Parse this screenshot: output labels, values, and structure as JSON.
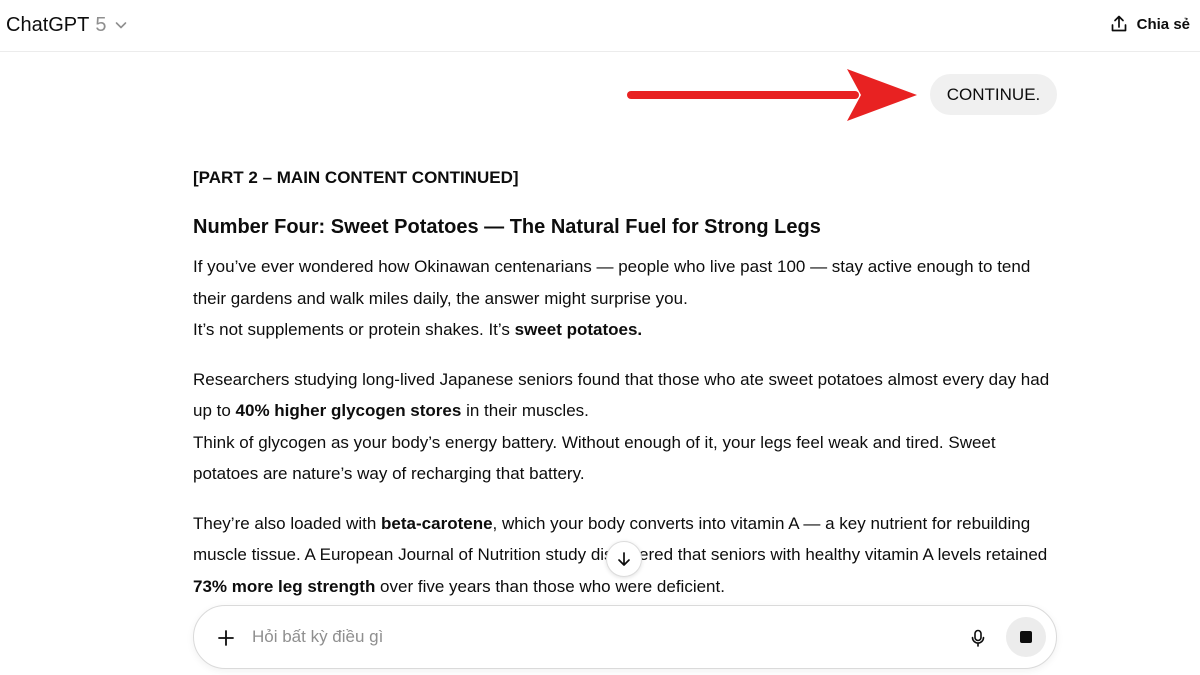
{
  "header": {
    "model_name": "ChatGPT",
    "model_version": "5",
    "share_label": "Chia sẻ"
  },
  "conversation": {
    "user_message": "CONTINUE.",
    "assistant": {
      "part_title": "[PART 2 – MAIN CONTENT CONTINUED]",
      "section_heading": "Number Four: Sweet Potatoes — The Natural Fuel for Strong Legs",
      "paragraphs": [
        {
          "lines": [
            [
              "If you’ve ever wondered how Okinawan centenarians — people who live past 100 — stay active enough to tend their gardens and walk miles daily, the answer might surprise you."
            ],
            [
              "It’s not supplements or protein shakes. It’s ",
              {
                "b": "sweet potatoes."
              }
            ]
          ]
        },
        {
          "lines": [
            [
              "Researchers studying long-lived Japanese seniors found that those who ate sweet potatoes almost every day had up to ",
              {
                "b": "40% higher glycogen stores"
              },
              " in their muscles."
            ],
            [
              "Think of glycogen as your body’s energy battery. Without enough of it, your legs feel weak and tired. Sweet potatoes are nature’s way of recharging that battery."
            ]
          ]
        },
        {
          "lines": [
            [
              "They’re also loaded with ",
              {
                "b": "beta-carotene"
              },
              ", which your body converts into vitamin A — a key nutrient for rebuilding muscle tissue. A European Journal of Nutrition study discovered that seniors with healthy vitamin A levels retained ",
              {
                "b": "73% more leg strength"
              },
              " over five years than those who were deficient."
            ]
          ]
        }
      ]
    }
  },
  "composer": {
    "placeholder": "Hỏi bất kỳ điều gì",
    "value": ""
  },
  "icons": {
    "model_menu": "chevron-down-icon",
    "share": "share-upload-icon",
    "scroll": "arrow-down-icon",
    "attach": "plus-icon",
    "voice": "microphone-icon",
    "stop": "stop-icon"
  },
  "colors": {
    "annotation_arrow": "#e82222",
    "user_bubble": "#f0f0f0",
    "text": "#0d0d0d",
    "muted": "#8f8f8f"
  }
}
